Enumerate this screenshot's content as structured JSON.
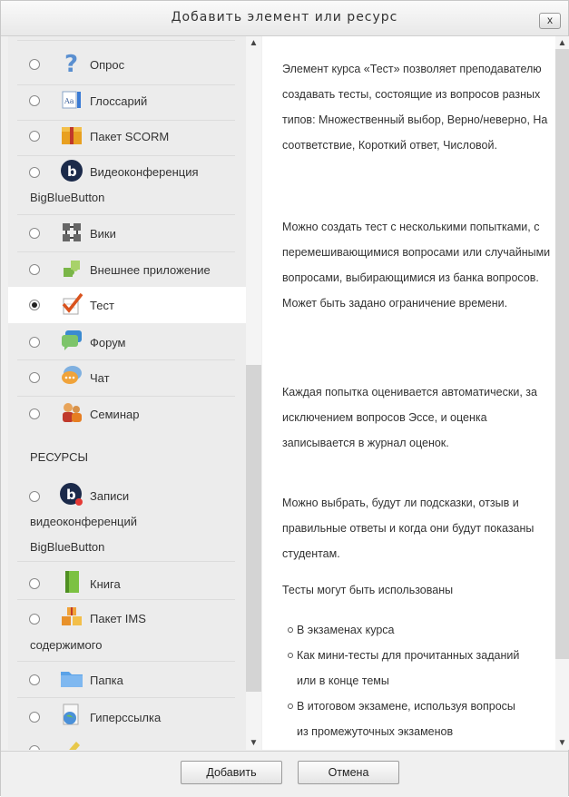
{
  "dialog": {
    "title": "Добавить элемент или ресурс",
    "close_label": "x"
  },
  "activities": [
    {
      "label": "Опрос",
      "icon": "question-icon",
      "selected": false
    },
    {
      "label": "Глоссарий",
      "icon": "glossary-icon",
      "selected": false
    },
    {
      "label": "Пакет SCORM",
      "icon": "scorm-package-icon",
      "selected": false
    },
    {
      "label": "Видеоконференция",
      "label_cont": "BigBlueButton",
      "icon": "bigbluebutton-icon",
      "selected": false
    },
    {
      "label": "Вики",
      "icon": "wiki-icon",
      "selected": false
    },
    {
      "label": "Внешнее приложение",
      "icon": "puzzle-icon",
      "selected": false
    },
    {
      "label": "Тест",
      "icon": "quiz-icon",
      "selected": true
    },
    {
      "label": "Форум",
      "icon": "forum-icon",
      "selected": false
    },
    {
      "label": "Чат",
      "icon": "chat-icon",
      "selected": false
    },
    {
      "label": "Семинар",
      "icon": "workshop-icon",
      "selected": false
    }
  ],
  "resources_heading": "РЕСУРСЫ",
  "resources": [
    {
      "label": "Записи",
      "label_cont": "видеоконференций",
      "label_cont2": "BigBlueButton",
      "icon": "recordings-icon",
      "selected": false
    },
    {
      "label": "Книга",
      "icon": "book-icon",
      "selected": false
    },
    {
      "label": "Пакет IMS",
      "label_cont": "содержимого",
      "icon": "ims-package-icon",
      "selected": false
    },
    {
      "label": "Папка",
      "icon": "folder-icon",
      "selected": false
    },
    {
      "label": "Гиперссылка",
      "icon": "url-icon",
      "selected": false
    }
  ],
  "description": {
    "p1": "Элемент курса «Тест» позволяет преподавателю создавать тесты, состоящие из вопросов разных типов: Множественный выбор, Верно/неверно, На соответствие, Короткий ответ, Числовой.",
    "p2": "Можно создать тест с несколькими попытками, с перемешивающимися вопросами или случайными вопросами, выбирающимися из банка вопросов. Может быть задано ограничение времени.",
    "p3": "Каждая попытка оценивается автоматически, за исключением вопросов Эссе, и оценка записывается в журнал оценок.",
    "p4": "Можно выбрать, будут ли подсказки, отзыв и правильные ответы и когда они будут показаны студентам.",
    "p5": "Тесты могут быть использованы",
    "bullets": [
      "В экзаменах курса",
      "Как мини-тесты для прочитанных заданий или в конце темы",
      "В итоговом экзамене, используя вопросы из промежуточных экзаменов"
    ]
  },
  "buttons": {
    "add": "Добавить",
    "cancel": "Отмена"
  },
  "colors": {
    "selected_row": "#ffffff",
    "pane_bg": "#ececec"
  }
}
